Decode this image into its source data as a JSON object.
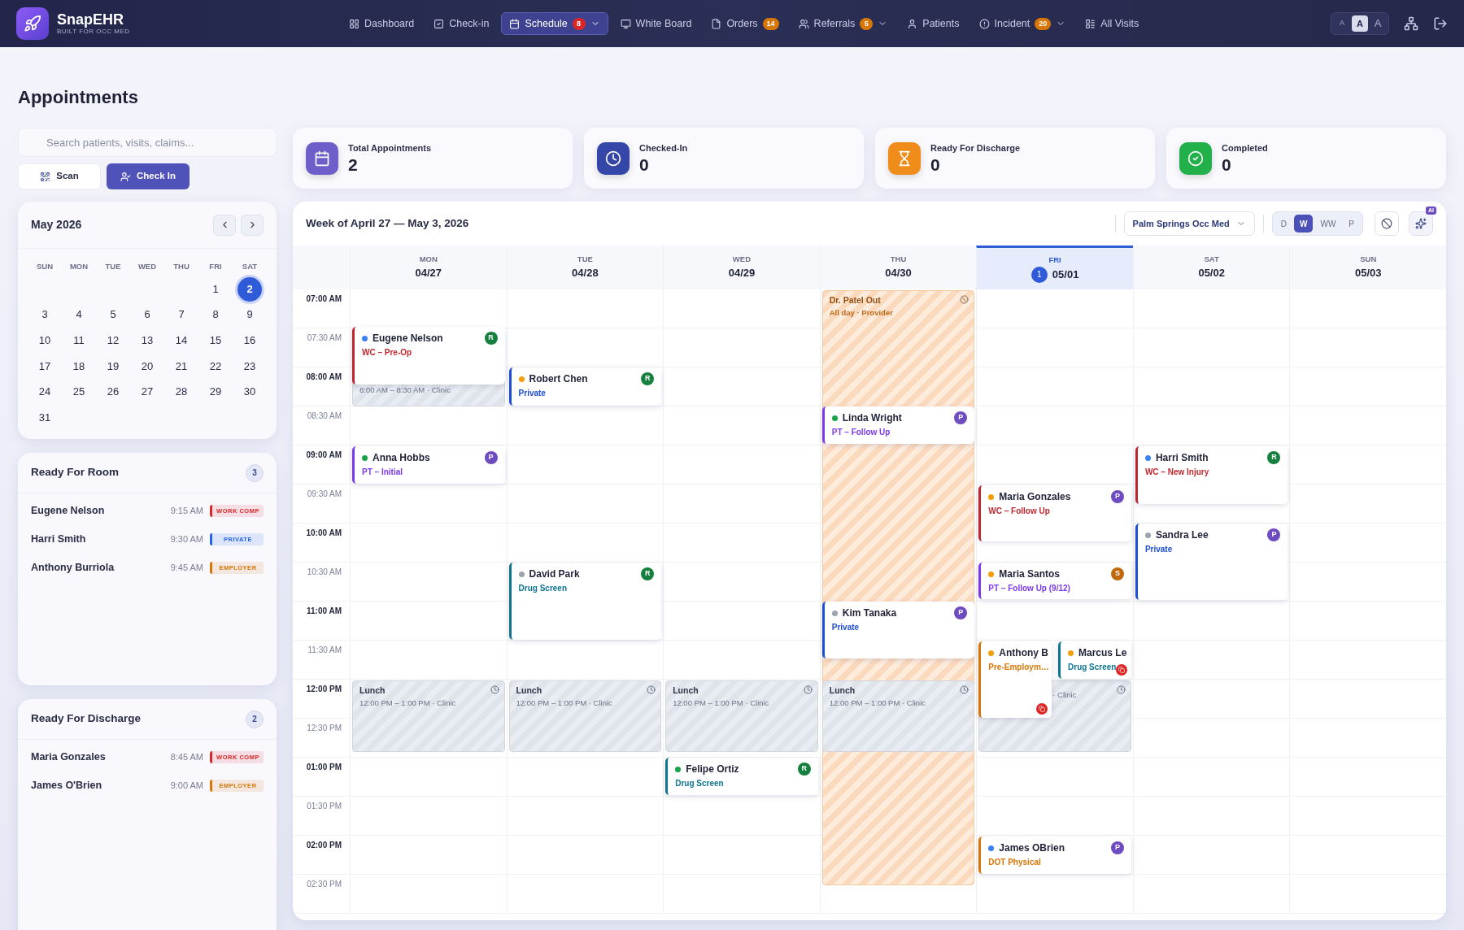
{
  "app": {
    "name": "SnapEHR",
    "tagline": "BUILT FOR OCC MED"
  },
  "nav": {
    "items": [
      {
        "label": "Dashboard",
        "selected": false
      },
      {
        "label": "Check-in",
        "selected": false
      },
      {
        "label": "Schedule",
        "selected": true,
        "badge": {
          "label": "8",
          "color": "#dc2626"
        },
        "menu": true
      },
      {
        "label": "White Board",
        "selected": false
      },
      {
        "label": "Orders",
        "selected": false,
        "badge": {
          "label": "14",
          "color": "#d97706"
        }
      },
      {
        "label": "Referrals",
        "selected": false,
        "badge": {
          "label": "5",
          "color": "#d97706"
        },
        "menu": true
      },
      {
        "label": "Patients",
        "selected": false
      },
      {
        "label": "Incident",
        "selected": false,
        "badge": {
          "label": "20",
          "color": "#d97706"
        },
        "menu": true
      },
      {
        "label": "All Visits",
        "selected": false
      }
    ],
    "font_sizes": [
      {
        "label": "A",
        "selected": false
      },
      {
        "label": "A",
        "selected": true
      },
      {
        "label": "A",
        "selected": false
      }
    ]
  },
  "page_title": "Appointments",
  "search": {
    "placeholder": "Search patients, visits, claims..."
  },
  "actions": [
    {
      "label": "Scan",
      "kind": "secondary"
    },
    {
      "label": "Check In",
      "kind": "primary"
    }
  ],
  "mini_calendar": {
    "title": "May 2026",
    "weekdays": [
      "SUN",
      "MON",
      "TUE",
      "WED",
      "THU",
      "FRI",
      "SAT"
    ],
    "days": [
      {
        "label": "1",
        "selected": false
      },
      {
        "label": "2",
        "selected": true
      },
      {
        "label": "3",
        "selected": false
      },
      {
        "label": "4",
        "selected": false
      },
      {
        "label": "5",
        "selected": false
      },
      {
        "label": "6",
        "selected": false
      },
      {
        "label": "7",
        "selected": false
      },
      {
        "label": "8",
        "selected": false
      },
      {
        "label": "9",
        "selected": false
      },
      {
        "label": "10",
        "selected": false
      },
      {
        "label": "11",
        "selected": false
      },
      {
        "label": "12",
        "selected": false
      },
      {
        "label": "13",
        "selected": false
      },
      {
        "label": "14",
        "selected": false
      },
      {
        "label": "15",
        "selected": false
      },
      {
        "label": "16",
        "selected": false
      },
      {
        "label": "17",
        "selected": false
      },
      {
        "label": "18",
        "selected": false
      },
      {
        "label": "19",
        "selected": false
      },
      {
        "label": "20",
        "selected": false
      },
      {
        "label": "21",
        "selected": false
      },
      {
        "label": "22",
        "selected": false
      },
      {
        "label": "23",
        "selected": false
      },
      {
        "label": "24",
        "selected": false
      },
      {
        "label": "25",
        "selected": false
      },
      {
        "label": "26",
        "selected": false
      },
      {
        "label": "27",
        "selected": false
      },
      {
        "label": "28",
        "selected": false
      },
      {
        "label": "29",
        "selected": false
      },
      {
        "label": "30",
        "selected": false
      },
      {
        "label": "31",
        "selected": false
      }
    ]
  },
  "queues": [
    {
      "title": "Ready For Room",
      "count": "3",
      "rows": [
        {
          "name": "Eugene Nelson",
          "time": "9:15 AM",
          "tag": "WORK COMP",
          "color": "#dc2626"
        },
        {
          "name": "Harri Smith",
          "time": "9:30 AM",
          "tag": "PRIVATE",
          "color": "#2563eb"
        },
        {
          "name": "Anthony Burriola",
          "time": "9:45 AM",
          "tag": "EMPLOYER",
          "color": "#d97706"
        }
      ]
    },
    {
      "title": "Ready For Discharge",
      "count": "2",
      "rows": [
        {
          "name": "Maria Gonzales",
          "time": "8:45 AM",
          "tag": "WORK COMP",
          "color": "#dc2626"
        },
        {
          "name": "James O'Brien",
          "time": "9:00 AM",
          "tag": "EMPLOYER",
          "color": "#d97706"
        }
      ]
    }
  ],
  "stats": [
    {
      "label": "Total Appointments",
      "value": "2",
      "color": "#6d5fc9"
    },
    {
      "label": "Checked-In",
      "value": "0",
      "color": "#3446a8"
    },
    {
      "label": "Ready For Discharge",
      "value": "0",
      "color": "#f08c1a"
    },
    {
      "label": "Completed",
      "value": "0",
      "color": "#22b04b"
    }
  ],
  "schedule": {
    "title": "Week of April 27 — May 3, 2026",
    "location": "Palm Springs Occ Med",
    "views": [
      {
        "label": "D",
        "selected": false
      },
      {
        "label": "W",
        "selected": true
      },
      {
        "label": "WW",
        "selected": false
      },
      {
        "label": "P",
        "selected": false
      }
    ],
    "ai_badge": "AI",
    "times": [
      {
        "label": "07:00 AM",
        "kind": "hour"
      },
      {
        "label": "07:30 AM",
        "kind": "half"
      },
      {
        "label": "08:00 AM",
        "kind": "hour"
      },
      {
        "label": "08:30 AM",
        "kind": "half"
      },
      {
        "label": "09:00 AM",
        "kind": "hour"
      },
      {
        "label": "09:30 AM",
        "kind": "half"
      },
      {
        "label": "10:00 AM",
        "kind": "hour"
      },
      {
        "label": "10:30 AM",
        "kind": "half"
      },
      {
        "label": "11:00 AM",
        "kind": "hour"
      },
      {
        "label": "11:30 AM",
        "kind": "half"
      },
      {
        "label": "12:00 PM",
        "kind": "hour"
      },
      {
        "label": "12:30 PM",
        "kind": "half"
      },
      {
        "label": "01:00 PM",
        "kind": "hour"
      },
      {
        "label": "01:30 PM",
        "kind": "half"
      },
      {
        "label": "02:00 PM",
        "kind": "hour"
      },
      {
        "label": "02:30 PM",
        "kind": "half"
      }
    ],
    "days": [
      {
        "weekday": "MON",
        "date": "04/27",
        "selected": false,
        "events": [
          {
            "kind": "appointment",
            "name": "Eugene Nelson",
            "subtitle": "WC – Pre-Op",
            "color": "#c0262d",
            "dot": {
              "color": "#3b82f6"
            },
            "badge": {
              "label": "R",
              "color": "#15803d"
            },
            "flagged": false
          },
          {
            "kind": "block",
            "subtitle": "8:00 AM – 8:30 AM · Clinic"
          },
          {
            "kind": "appointment",
            "name": "Anna Hobbs",
            "subtitle": "PT – Initial",
            "color": "#7c3aed",
            "dot": {
              "color": "#16a34a"
            },
            "badge": {
              "label": "P",
              "color": "#6d4bc0"
            },
            "flagged": false
          },
          {
            "kind": "block",
            "title": "Lunch",
            "subtitle": "12:00 PM – 1:00 PM · Clinic"
          }
        ]
      },
      {
        "weekday": "TUE",
        "date": "04/28",
        "selected": false,
        "events": [
          {
            "kind": "appointment",
            "name": "Robert Chen",
            "subtitle": "Private",
            "color": "#1d4ed8",
            "dot": {
              "color": "#f59e0b"
            },
            "badge": {
              "label": "R",
              "color": "#15803d"
            },
            "flagged": false
          },
          {
            "kind": "appointment",
            "name": "David Park",
            "subtitle": "Drug Screen",
            "color": "#0e7490",
            "dot": {
              "color": "#9ca3af"
            },
            "badge": {
              "label": "R",
              "color": "#15803d"
            },
            "flagged": false
          },
          {
            "kind": "block",
            "title": "Lunch",
            "subtitle": "12:00 PM – 1:00 PM · Clinic"
          }
        ]
      },
      {
        "weekday": "WED",
        "date": "04/29",
        "selected": false,
        "events": [
          {
            "kind": "block",
            "title": "Lunch",
            "subtitle": "12:00 PM – 1:00 PM · Clinic"
          },
          {
            "kind": "appointment",
            "name": "Felipe Ortiz",
            "subtitle": "Drug Screen",
            "color": "#0e7490",
            "dot": {
              "color": "#16a34a"
            },
            "badge": {
              "label": "R",
              "color": "#15803d"
            },
            "flagged": false
          }
        ]
      },
      {
        "weekday": "THU",
        "date": "04/30",
        "selected": false,
        "events": [
          {
            "kind": "out",
            "title": "Dr. Patel Out",
            "subtitle": "All day · Provider"
          },
          {
            "kind": "appointment",
            "name": "Linda Wright",
            "subtitle": "PT – Follow Up",
            "color": "#7c3aed",
            "dot": {
              "color": "#16a34a"
            },
            "badge": {
              "label": "P",
              "color": "#6d4bc0"
            },
            "flagged": false
          },
          {
            "kind": "appointment",
            "name": "Kim Tanaka",
            "subtitle": "Private",
            "color": "#1d4ed8",
            "dot": {
              "color": "#9ca3af"
            },
            "badge": {
              "label": "P",
              "color": "#6d4bc0"
            },
            "flagged": false
          },
          {
            "kind": "block",
            "title": "Lunch",
            "subtitle": "12:00 PM – 1:00 PM · Clinic"
          }
        ]
      },
      {
        "weekday": "FRI",
        "date": "05/01",
        "selected": true,
        "badge": "1",
        "events": [
          {
            "kind": "appointment",
            "name": "Maria Gonzales",
            "subtitle": "WC – Follow Up",
            "color": "#c0262d",
            "dot": {
              "color": "#f59e0b"
            },
            "badge": {
              "label": "P",
              "color": "#6d4bc0"
            },
            "flagged": false
          },
          {
            "kind": "appointment",
            "name": "Maria Santos",
            "subtitle": "PT – Follow Up (9/12)",
            "color": "#7c3aed",
            "dot": {
              "color": "#f59e0b"
            },
            "badge": {
              "label": "S",
              "color": "#c2680c"
            },
            "flagged": false
          },
          {
            "kind": "appointment",
            "name": "Anthony B",
            "subtitle": "Pre-Employm…",
            "color": "#d97706",
            "dot": {
              "color": "#f59e0b"
            },
            "flagged": true
          },
          {
            "kind": "appointment",
            "name": "Marcus Le",
            "subtitle": "Drug Screen",
            "color": "#0e7490",
            "dot": {
              "color": "#f59e0b"
            },
            "flagged": true
          },
          {
            "kind": "block",
            "subtitle": "· Clinic"
          },
          {
            "kind": "appointment",
            "name": "James OBrien",
            "subtitle": "DOT Physical",
            "color": "#d97706",
            "dot": {
              "color": "#3b82f6"
            },
            "badge": {
              "label": "P",
              "color": "#6d4bc0"
            },
            "flagged": false
          }
        ]
      },
      {
        "weekday": "SAT",
        "date": "05/02",
        "selected": false,
        "events": [
          {
            "kind": "appointment",
            "name": "Harri Smith",
            "subtitle": "WC – New Injury",
            "color": "#c0262d",
            "dot": {
              "color": "#3b82f6"
            },
            "badge": {
              "label": "R",
              "color": "#15803d"
            },
            "flagged": false
          },
          {
            "kind": "appointment",
            "name": "Sandra Lee",
            "subtitle": "Private",
            "color": "#1d4ed8",
            "dot": {
              "color": "#9ca3af"
            },
            "badge": {
              "label": "P",
              "color": "#6d4bc0"
            },
            "flagged": false
          }
        ]
      },
      {
        "weekday": "SUN",
        "date": "05/03",
        "selected": false
      }
    ]
  }
}
